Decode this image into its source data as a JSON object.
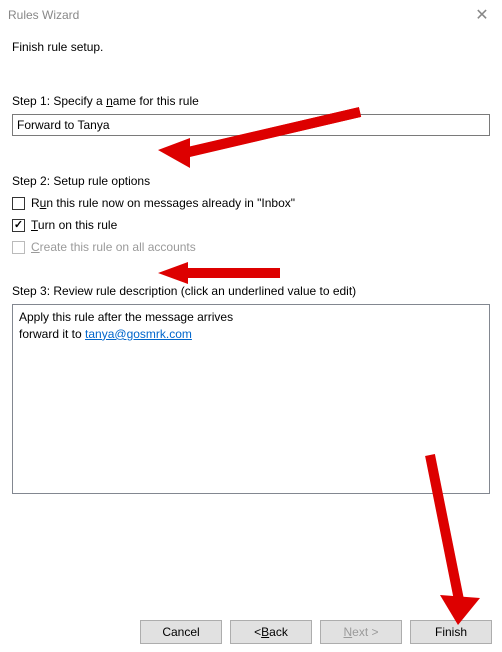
{
  "window": {
    "title": "Rules Wizard"
  },
  "heading": "Finish rule setup.",
  "step1": {
    "label_prefix": "Step 1: Specify a ",
    "underline": "n",
    "label_suffix": "ame for this rule",
    "value": "Forward to Tanya"
  },
  "step2": {
    "label": "Step 2: Setup rule options",
    "run_now": {
      "prefix": "R",
      "underline": "u",
      "suffix": "n this rule now on messages already in \"Inbox\"",
      "checked": false
    },
    "turn_on": {
      "underline": "T",
      "suffix": "urn on this rule",
      "checked": true
    },
    "all_accounts": {
      "underline": "C",
      "suffix": "reate this rule on all accounts",
      "enabled": false
    }
  },
  "step3": {
    "label": "Step 3: Review rule description (click an underlined value to edit)",
    "line1": "Apply this rule after the message arrives",
    "line2_prefix": "forward it to ",
    "link": "tanya@gosmrk.com"
  },
  "buttons": {
    "cancel": "Cancel",
    "back_prefix": "< ",
    "back_underline": "B",
    "back_suffix": "ack",
    "next_underline": "N",
    "next_suffix": "ext >",
    "finish": "Finish"
  }
}
